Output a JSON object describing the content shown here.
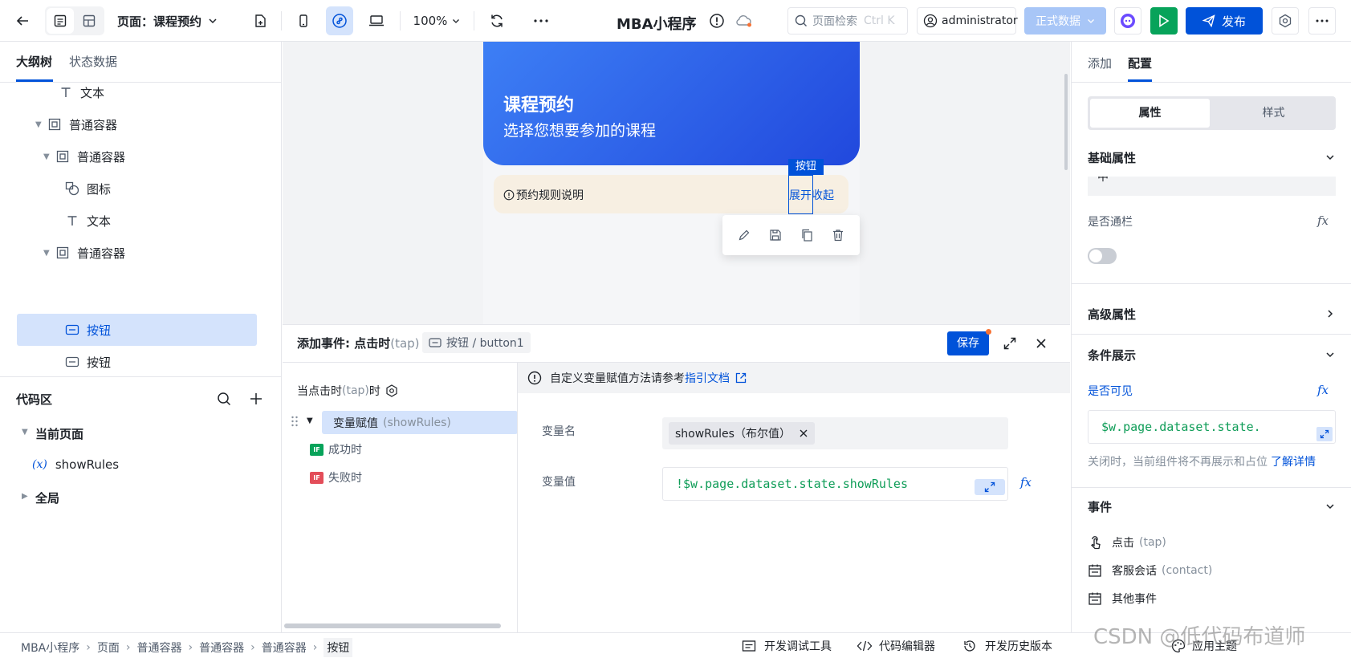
{
  "topbar": {
    "page_label": "页面：",
    "page_name": "课程预约",
    "zoom": "100%",
    "app_title": "MBA小程序",
    "search_placeholder": "页面检索",
    "search_shortcut": "Ctrl K",
    "user": "administrator",
    "env": "正式数据",
    "publish": "发布"
  },
  "left": {
    "tabs": [
      "大纲树",
      "状态数据"
    ],
    "tree": [
      {
        "label": "文本",
        "icon": "text-icon"
      },
      {
        "label": "普通容器",
        "icon": "container-icon"
      },
      {
        "label": "普通容器",
        "icon": "container-icon"
      },
      {
        "label": "图标",
        "icon": "shapes-icon"
      },
      {
        "label": "文本",
        "icon": "text-icon"
      },
      {
        "label": "普通容器",
        "icon": "container-icon"
      },
      {
        "label": "按钮",
        "icon": "button-icon"
      },
      {
        "label": "按钮",
        "icon": "button-icon"
      }
    ],
    "code_title": "代码区",
    "code_current": "当前页面",
    "code_var": "showRules",
    "code_var_icon": "(x)",
    "code_global": "全局"
  },
  "canvas": {
    "hero_title": "课程预约",
    "hero_sub": "选择您想要参加的课程",
    "rules_label": "预约规则说明",
    "rules_btn1": "展开",
    "rules_btn2": "收起",
    "select_tag": "按钮"
  },
  "event": {
    "title_prefix": "添加事件: 点击时",
    "title_tap": "(tap)",
    "component": "按钮 / button1",
    "save": "保存",
    "trigger_prefix": "当点击时",
    "trigger_tap": "(tap)",
    "trigger_suffix": "时",
    "action": "变量赋值",
    "action_var": "(showRules)",
    "success": "成功时",
    "fail": "失败时",
    "if_label": "IF",
    "notice": "自定义变量赋值方法请参考",
    "notice_link": "指引文档",
    "var_name_label": "变量名",
    "var_name_tag": "showRules（布尔值）",
    "var_value_label": "变量值",
    "var_value": "!$w.page.dataset.state.showRules",
    "fx": "fx"
  },
  "right": {
    "tabs": [
      "添加",
      "配置"
    ],
    "seg": [
      "属性",
      "样式"
    ],
    "basic": "基础属性",
    "partial_value": "中",
    "full_width": "是否通栏",
    "advanced": "高级属性",
    "conditional": "条件展示",
    "visible": "是否可见",
    "visible_expr": "$w.page.dataset.state.",
    "hint": "关闭时，当前组件将不再展示和占位",
    "hint_link": "了解详情",
    "events": "事件",
    "event_items": [
      {
        "label": "点击",
        "sub": "(tap)"
      },
      {
        "label": "客服会话",
        "sub": "(contact)"
      },
      {
        "label": "其他事件",
        "sub": ""
      }
    ],
    "fx": "fx"
  },
  "status": {
    "crumbs": [
      "MBA小程序",
      "页面",
      "普通容器",
      "普通容器",
      "普通容器",
      "按钮"
    ],
    "tools": [
      "开发调试工具",
      "代码编辑器",
      "开发历史版本"
    ],
    "theme": "应用主题",
    "watermark": "CSDN @低代码布道师"
  },
  "colors": {
    "primary": "#0052d9",
    "selected_bg": "#d4e3fc",
    "hero_start": "#3d7ff5",
    "hero_end": "#2b57e6",
    "green": "#07a35a",
    "code_green": "#0f9d58",
    "rules_bg": "#f7efe2"
  }
}
